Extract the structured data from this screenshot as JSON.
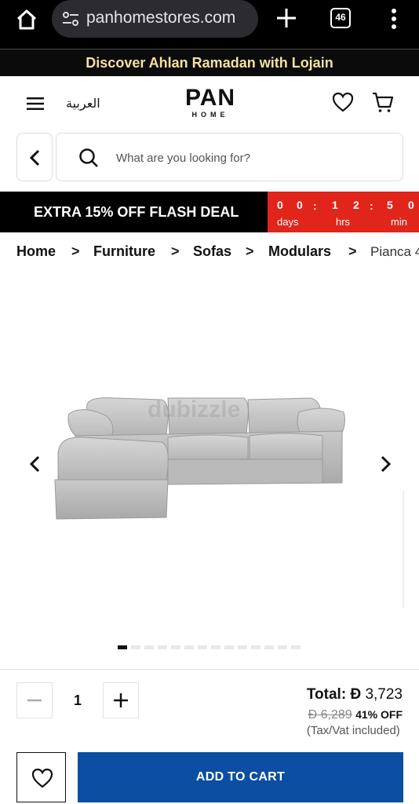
{
  "browser": {
    "url": "panhomestores.com",
    "tab_count": "46"
  },
  "promo": {
    "text": "Discover Ahlan Ramadan with Lojain"
  },
  "header": {
    "language_link": "العربية",
    "logo": {
      "brand": "PAN",
      "sub": "HOME"
    },
    "icons": [
      "menu-icon",
      "heart-icon",
      "cart-icon"
    ]
  },
  "search": {
    "placeholder": "What are you looking for?"
  },
  "flash_deal": {
    "label": "EXTRA 15% OFF FLASH DEAL",
    "days": [
      "0",
      "0"
    ],
    "hrs": [
      "1",
      "2"
    ],
    "min": [
      "5",
      "0"
    ],
    "days_label": "days",
    "hrs_label": "hrs",
    "min_label": "min",
    "colon": ":"
  },
  "breadcrumb": {
    "items": [
      "Home",
      "Furniture",
      "Sofas",
      "Modulars"
    ],
    "current": "Pianca 4",
    "separator": ">"
  },
  "gallery": {
    "watermark": "dubizzle",
    "slide_count": 14,
    "active_index": 0
  },
  "purchase": {
    "quantity": "1",
    "total_label": "Total:",
    "currency": "Đ",
    "total_price": "3,723",
    "old_price": "6,289",
    "discount": "41% OFF",
    "tax_note": "(Tax/Vat included)",
    "add_to_cart": "ADD TO CART"
  },
  "colors": {
    "flash_red": "#e1251b",
    "add_to_cart_blue": "#0b4ea2",
    "promo_text": "#f3e2a0"
  }
}
